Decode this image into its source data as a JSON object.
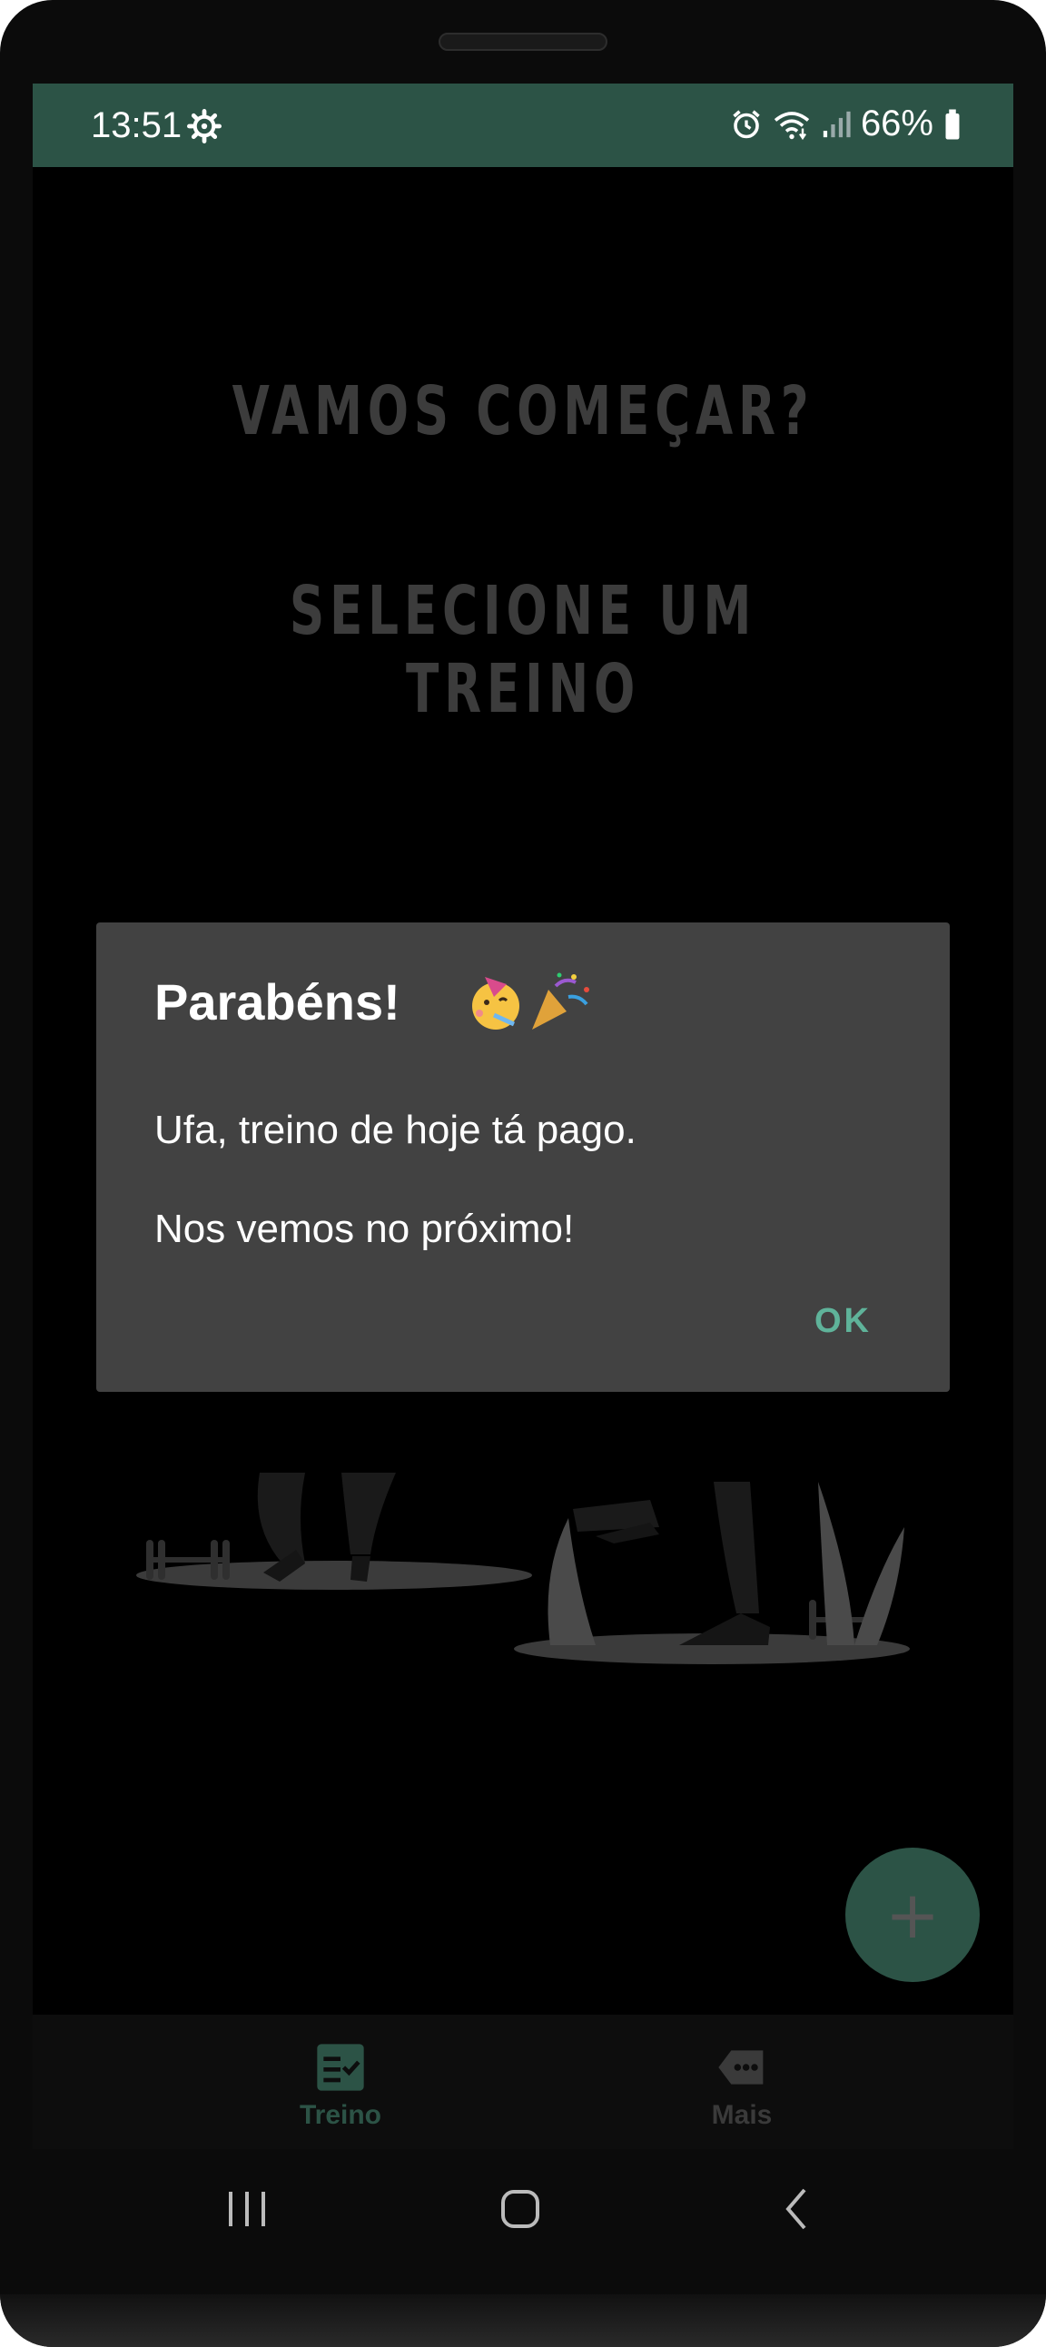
{
  "status_bar": {
    "time": "13:51",
    "battery": "66%",
    "color": "#2c5346"
  },
  "main": {
    "heading_1": "VAMOS COMEÇAR?",
    "heading_2": "SELECIONE UM TREINO"
  },
  "dialog": {
    "title": "Parabéns!",
    "title_emoji": [
      "partying-face-icon",
      "party-popper-icon"
    ],
    "line_1": "Ufa, treino de hoje tá pago.",
    "line_2": "Nos vemos no próximo!",
    "ok_label": "OK",
    "ok_color": "#5fb39a"
  },
  "fab": {
    "icon": "plus-icon",
    "symbol": "+"
  },
  "bottom_nav": {
    "items": [
      {
        "label": "Treino",
        "icon": "checklist-icon",
        "active": true
      },
      {
        "label": "Mais",
        "icon": "more-tag-icon",
        "active": false
      }
    ]
  },
  "system_nav": {
    "buttons": [
      "recents-icon",
      "home-icon",
      "back-icon"
    ]
  }
}
